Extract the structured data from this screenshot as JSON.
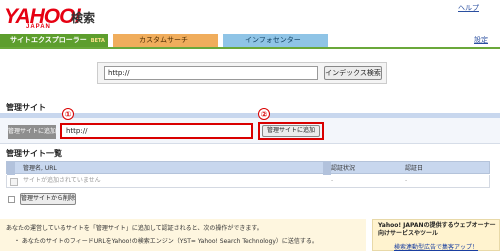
{
  "header": {
    "logo": "YAHOO!",
    "logo_sub": "JAPAN",
    "service": "検索",
    "top_link": "ヘルプ"
  },
  "tabs": [
    {
      "label": "サイトエクスプローラー",
      "badge": "BETA"
    },
    {
      "label": "カスタムサーチ"
    },
    {
      "label": "インフォセンター"
    }
  ],
  "settings_link": "設定",
  "search": {
    "input_value": "http://",
    "button_label": "インデックス検索"
  },
  "manage": {
    "title": "管理サイト",
    "row_label": "管理サイトに追加",
    "input_value": "http://",
    "add_button": "管理サイトに追加",
    "callout_1": "①",
    "callout_2": "②"
  },
  "site_list": {
    "title": "管理サイト一覧",
    "columns": [
      "管理名, URL",
      "認証状況",
      "認証日"
    ],
    "empty_message": "サイトが追加されていません",
    "empty_status": "-",
    "empty_date": "-",
    "delete_button": "管理サイトから削除"
  },
  "notes": {
    "line1": "あなたの運営しているサイトを「管理サイト」に追加して認証されると、次の操作ができます。",
    "line2": "・ あなたのサイトのフィードURLをYahoo!の検索エンジン（YST= Yahoo! Search Technology）に送信する。"
  },
  "ad": {
    "text": "Yahoo! JAPANの提供するウェブオーナー向けサービスやツール",
    "link": "検索連動型広告で集客アップ！"
  },
  "colors": {
    "brand_red": "#e60012",
    "tab_green": "#5d9e2d",
    "tab_orange": "#f0ad5c",
    "tab_blue": "#8fc4e6",
    "highlight_red": "#d90000",
    "header_blue": "#c8d7ee"
  }
}
